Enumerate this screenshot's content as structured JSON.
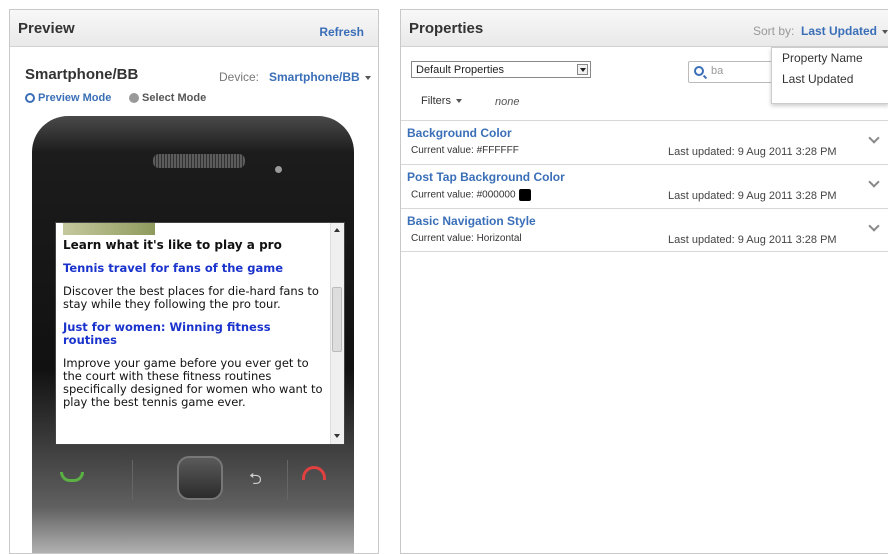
{
  "preview": {
    "title": "Preview",
    "refresh": "Refresh",
    "device_name": "Smartphone/BB",
    "device_label": "Device:",
    "device_value": "Smartphone/BB",
    "preview_mode": "Preview Mode",
    "select_mode": "Select Mode",
    "screen": {
      "heading": "Learn what it's like to play a pro",
      "link1": "Tennis travel for fans of the game",
      "para1": "Discover the best places for die-hard fans to stay while they following the pro tour.",
      "link2": "Just for women: Winning fitness routines",
      "para2": "Improve your game before you ever get to the court with these fitness routines specifically designed for women who want to play the best tennis game ever."
    }
  },
  "properties": {
    "title": "Properties",
    "sort_label": "Sort by:",
    "sort_value": "Last Updated",
    "sort_options": [
      "Property Name",
      "Last Updated"
    ],
    "dropdown_value": "Default Properties",
    "search_value": "ba",
    "filters_label": "Filters",
    "filters_value": "none",
    "items": [
      {
        "name": "Background Color",
        "current": "Current value: #FFFFFF",
        "updated": "Last updated: 9 Aug 2011 3:28 PM"
      },
      {
        "name": "Post Tap Background Color",
        "current": "Current value: #000000",
        "updated": "Last updated: 9 Aug 2011 3:28 PM",
        "swatch": "#000000"
      },
      {
        "name": "Basic Navigation Style",
        "current": "Current value: Horizontal",
        "updated": "Last updated: 9 Aug 2011 3:28 PM"
      }
    ]
  },
  "colors": {
    "accent": "#3a6fb8",
    "link": "#1a33cc"
  }
}
